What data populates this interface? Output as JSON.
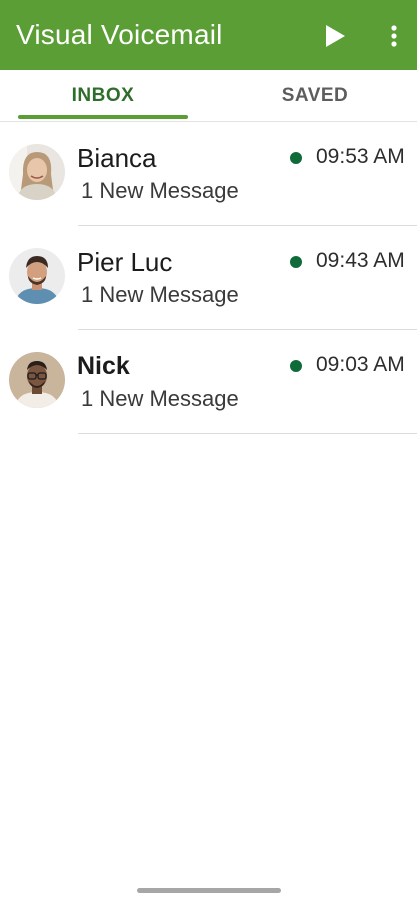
{
  "appbar": {
    "title": "Visual Voicemail",
    "background": "#5a9e35",
    "actions": [
      {
        "icon": "play-icon"
      },
      {
        "icon": "more-vert-icon"
      }
    ]
  },
  "tabs": [
    {
      "label": "INBOX",
      "selected": true
    },
    {
      "label": "SAVED",
      "selected": false
    }
  ],
  "accent_color": "#5a9e35",
  "unread_dot_color": "#0f6b3a",
  "messages": [
    {
      "name": "Bianca",
      "subtitle": "1 New Message",
      "time": "09:53 AM",
      "unread": true
    },
    {
      "name": "Pier Luc",
      "subtitle": "1 New Message",
      "time": "09:43 AM",
      "unread": true
    },
    {
      "name": "Nick",
      "subtitle": "1 New Message",
      "time": "09:03 AM",
      "unread": true
    }
  ]
}
